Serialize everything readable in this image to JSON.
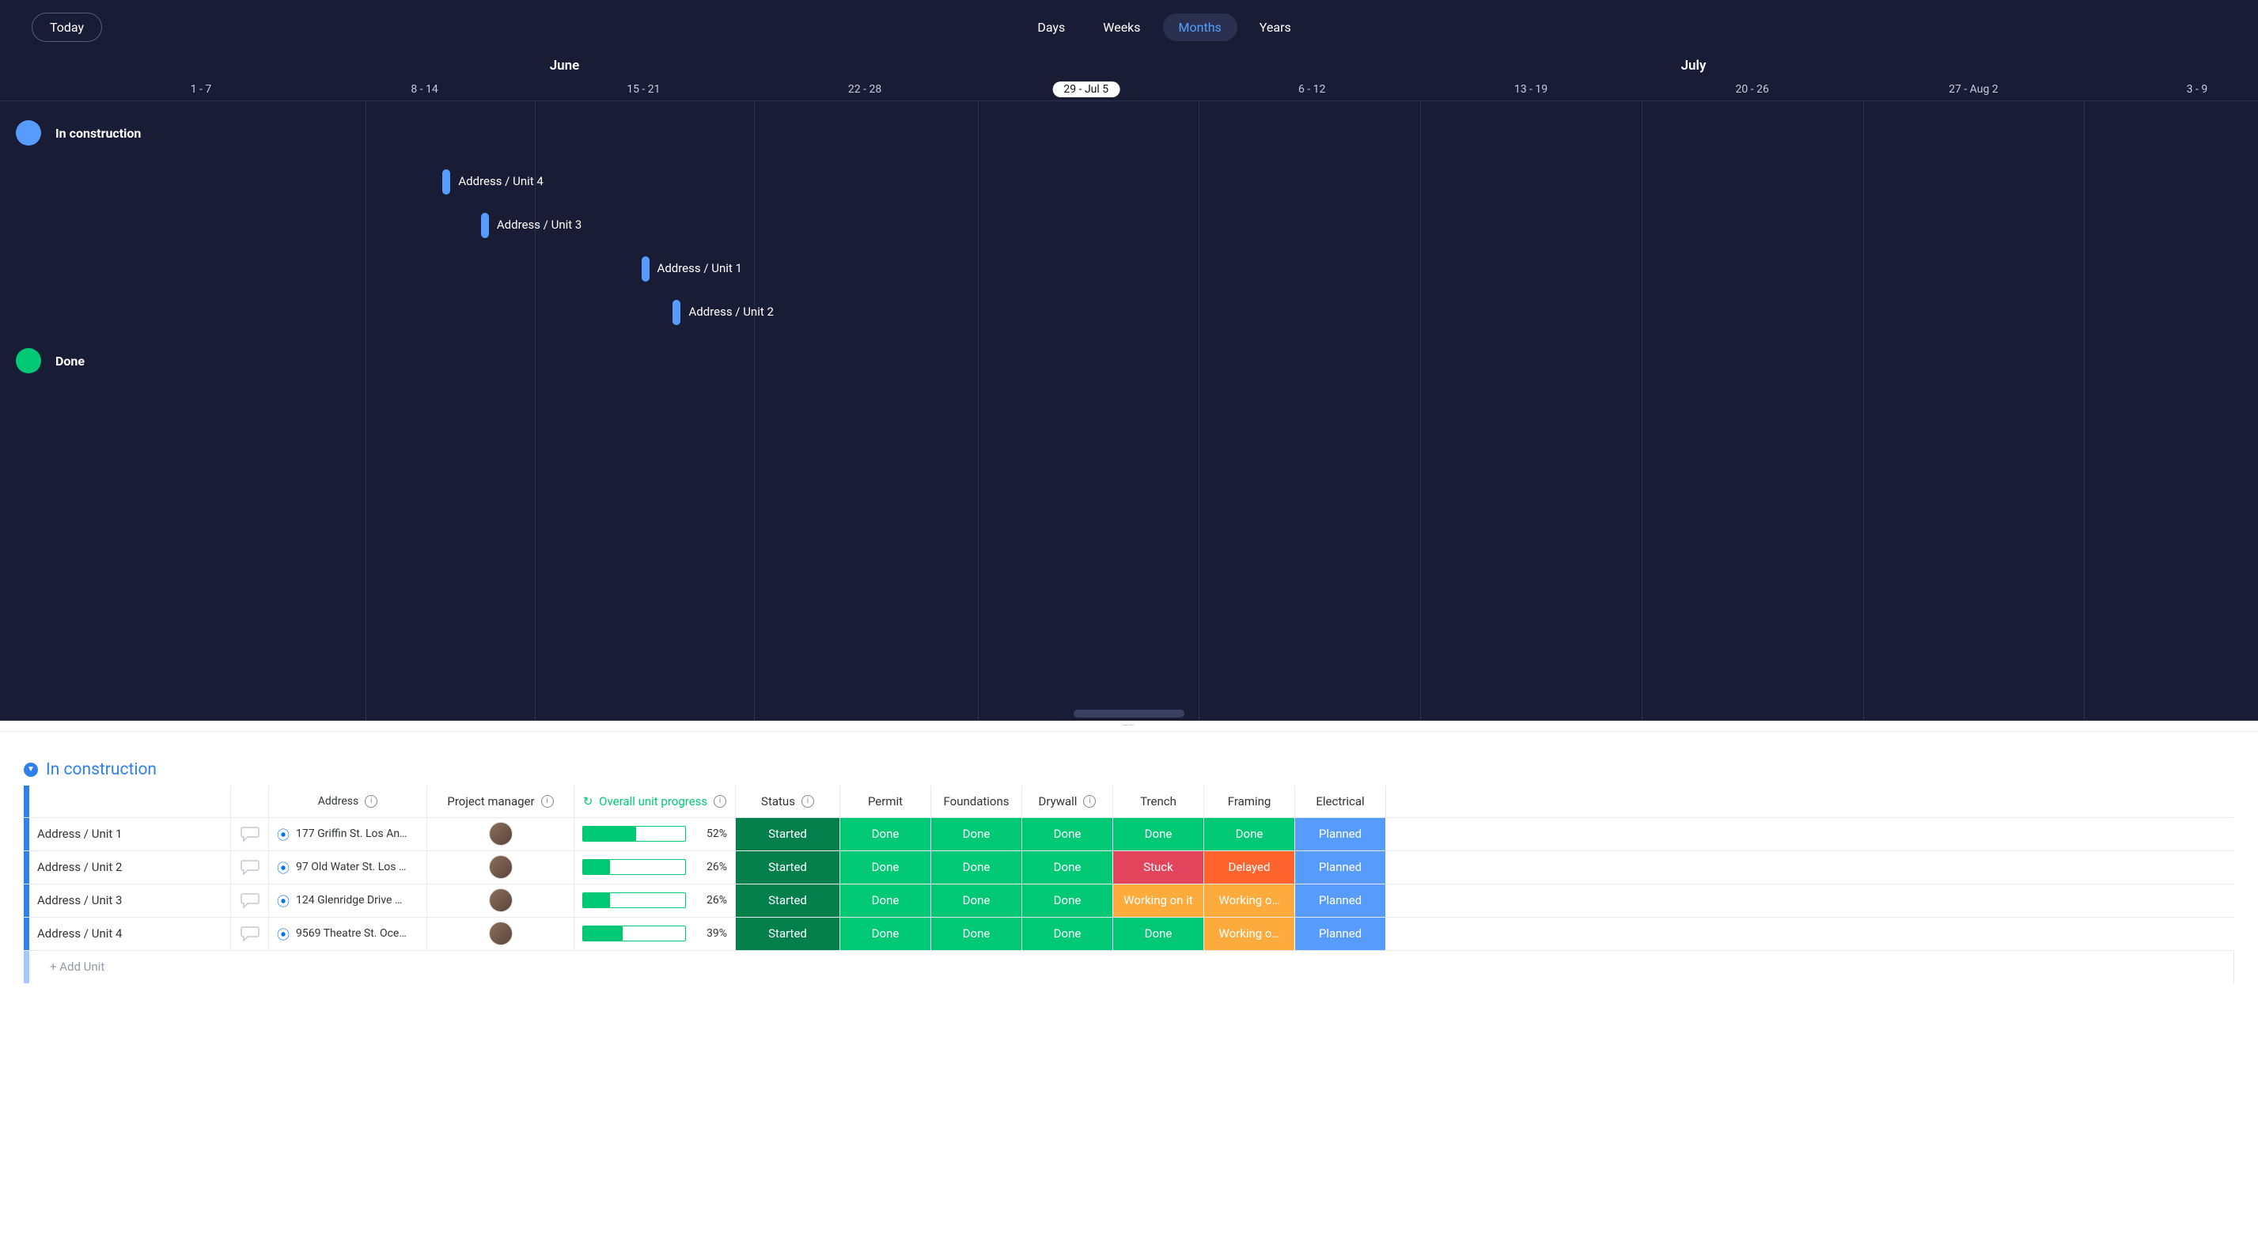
{
  "toolbar": {
    "today": "Today",
    "scale": {
      "days": "Days",
      "weeks": "Weeks",
      "months": "Months",
      "years": "Years",
      "active": "months"
    }
  },
  "timeline": {
    "months": [
      "June",
      "July"
    ],
    "weeks": [
      {
        "label": "1 - 7",
        "pos": 8.9
      },
      {
        "label": "8 - 14",
        "pos": 18.8
      },
      {
        "label": "15 - 21",
        "pos": 28.5
      },
      {
        "label": "22 - 28",
        "pos": 38.3
      },
      {
        "label": "29 - Jul 5",
        "pos": 48.1,
        "current": true
      },
      {
        "label": "6 - 12",
        "pos": 58.1
      },
      {
        "label": "13 - 19",
        "pos": 67.8
      },
      {
        "label": "20 - 26",
        "pos": 77.6
      },
      {
        "label": "27 - Aug 2",
        "pos": 87.4
      },
      {
        "label": "3 - 9",
        "pos": 97.3
      }
    ],
    "gridlines": [
      16.2,
      23.7,
      33.4,
      43.3,
      53.1,
      62.9,
      72.7,
      82.5,
      92.3
    ],
    "groups": [
      {
        "name": "In construction",
        "color": "#579bfc",
        "bars": [
          {
            "label": "Address / Unit 4",
            "left": 19.6
          },
          {
            "label": "Address / Unit 3",
            "left": 21.3
          },
          {
            "label": "Address / Unit 1",
            "left": 28.4
          },
          {
            "label": "Address / Unit 2",
            "left": 29.8
          }
        ]
      },
      {
        "name": "Done",
        "color": "#00c875",
        "bars": []
      }
    ]
  },
  "board": {
    "group_name": "In construction",
    "columns": {
      "address": "Address",
      "pm": "Project manager",
      "progress": "Overall unit progress",
      "status": "Status",
      "permit": "Permit",
      "found": "Foundations",
      "drywall": "Drywall",
      "trench": "Trench",
      "framing": "Framing",
      "electrical": "Electrical"
    },
    "rows": [
      {
        "name": "Address / Unit 1",
        "address": "177 Griffin St. Los An…",
        "progress": 52,
        "status": "Started",
        "steps": {
          "permit": "Done",
          "found": "Done",
          "drywall": "Done",
          "trench": "Done",
          "framing": "Done",
          "electrical": "Planned"
        }
      },
      {
        "name": "Address / Unit 2",
        "address": "97 Old Water St. Los …",
        "progress": 26,
        "status": "Started",
        "steps": {
          "permit": "Done",
          "found": "Done",
          "drywall": "Done",
          "trench": "Stuck",
          "framing": "Delayed",
          "electrical": "Planned"
        }
      },
      {
        "name": "Address / Unit 3",
        "address": "124 Glenridge Drive …",
        "progress": 26,
        "status": "Started",
        "steps": {
          "permit": "Done",
          "found": "Done",
          "drywall": "Done",
          "trench": "Working on it",
          "framing": "Working o…",
          "electrical": "Planned"
        }
      },
      {
        "name": "Address / Unit 4",
        "address": "9569 Theatre St. Oce…",
        "progress": 39,
        "status": "Started",
        "steps": {
          "permit": "Done",
          "found": "Done",
          "drywall": "Done",
          "trench": "Done",
          "framing": "Working o…",
          "electrical": "Planned"
        }
      }
    ],
    "add_row": "+ Add Unit"
  },
  "status_classes": {
    "Started": "bg-started",
    "Done": "bg-done",
    "Stuck": "bg-stuck",
    "Delayed": "bg-delay",
    "Working on it": "bg-work",
    "Working o…": "bg-work",
    "Planned": "bg-plan"
  }
}
